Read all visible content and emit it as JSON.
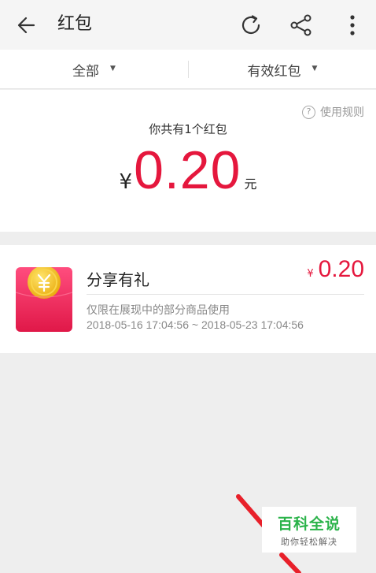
{
  "appbar": {
    "title": "红包",
    "icons": [
      "back-arrow-icon",
      "refresh-icon",
      "share-icon",
      "more-vertical-icon"
    ]
  },
  "filters": {
    "all_label": "全部",
    "valid_label": "有效红包"
  },
  "summary": {
    "rules_label": "使用规则",
    "count_text": "你共有1个红包",
    "currency": "¥",
    "amount": "0.20",
    "unit": "元"
  },
  "coupons": [
    {
      "title": "分享有礼",
      "currency": "¥",
      "amount": "0.20",
      "description": "仅限在展现中的部分商品使用",
      "validity": "2018-05-16 17:04:56 ~ 2018-05-23 17:04:56"
    }
  ],
  "watermark": {
    "title": "百科全说",
    "subtitle": "助你轻松解决"
  },
  "colors": {
    "accent": "#e5173d",
    "envelope_top": "#ff4d7e",
    "envelope_bottom": "#e01848",
    "coin": "#f5c518",
    "watermark_green": "#2bb34a"
  }
}
